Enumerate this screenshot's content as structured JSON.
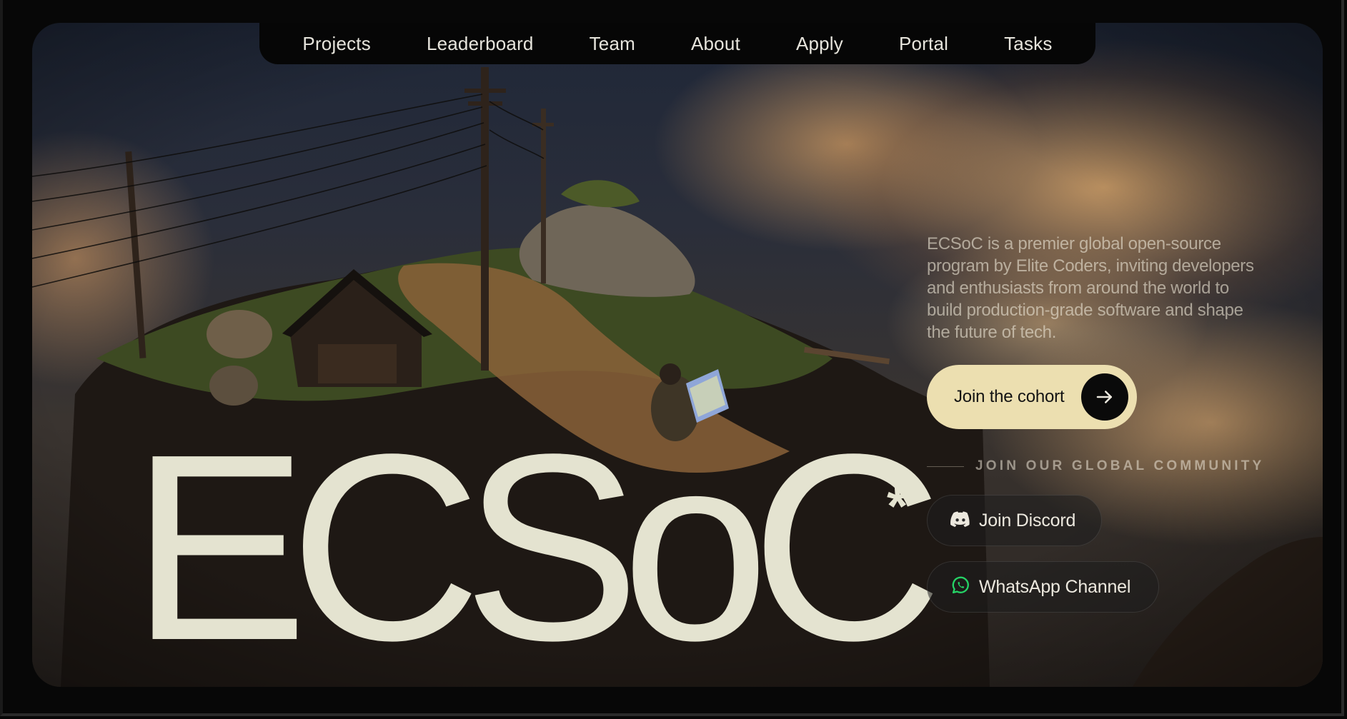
{
  "nav": {
    "items": [
      {
        "label": "Projects"
      },
      {
        "label": "Leaderboard"
      },
      {
        "label": "Team"
      },
      {
        "label": "About"
      },
      {
        "label": "Apply"
      },
      {
        "label": "Portal"
      },
      {
        "label": "Tasks"
      }
    ]
  },
  "hero": {
    "wordmark": "ECSoC",
    "asterisk": "*",
    "description": "ECSoC is a premier global open-source program by Elite Coders, inviting developers and enthusiasts from around the world to build production-grade software and shape the future of tech.",
    "cta_label": "Join the cohort",
    "cta_icon": "arrow-right-icon",
    "community_label": "JOIN OUR GLOBAL COMMUNITY",
    "links": {
      "discord_label": "Join Discord",
      "discord_icon": "discord-icon",
      "whatsapp_label": "WhatsApp Channel",
      "whatsapp_icon": "whatsapp-icon"
    }
  },
  "colors": {
    "page_background": "#070707",
    "nav_background": "#060606",
    "wordmark": "#e4e3d0",
    "cta_background": "#ecdfb0",
    "whatsapp_green": "#25d366"
  }
}
